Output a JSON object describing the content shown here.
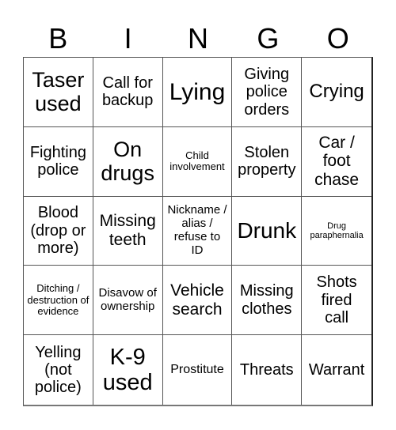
{
  "header": {
    "letters": [
      "B",
      "I",
      "N",
      "G",
      "O"
    ]
  },
  "cells": [
    "Taser used",
    "Call for backup",
    "Lying",
    "Giving police orders",
    "Crying",
    "Fighting police",
    "On drugs",
    "Child involvement",
    "Stolen property",
    "Car / foot chase",
    "Blood (drop or more)",
    "Missing teeth",
    "Nickname / alias / refuse to ID",
    "Drunk",
    "Drug paraphernalia",
    "Ditching / destruction of evidence",
    "Disavow of ownership",
    "Vehicle search",
    "Missing clothes",
    "Shots fired call",
    "Yelling (not police)",
    "K-9 used",
    "Prostitute",
    "Threats",
    "Warrant"
  ]
}
